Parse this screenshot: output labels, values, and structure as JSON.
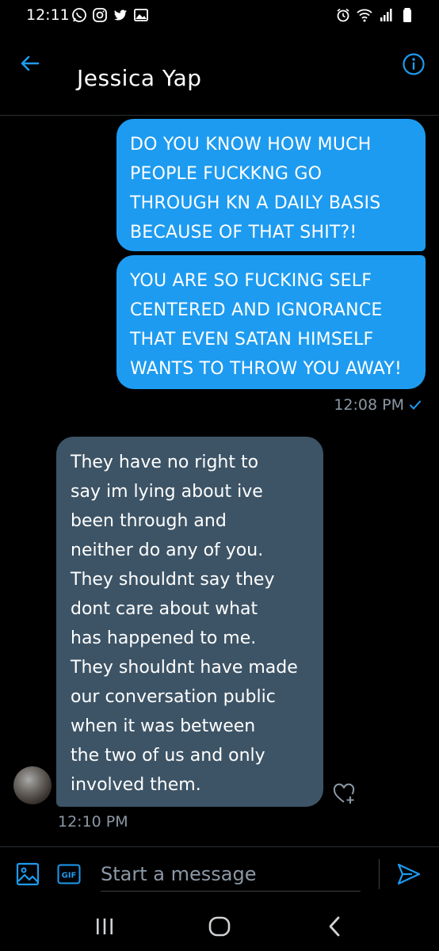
{
  "status_bar": {
    "time": "12:11",
    "left_icons": [
      "whatsapp-icon",
      "instagram-icon",
      "twitter-icon",
      "gallery-icon"
    ],
    "right_icons": [
      "alarm-icon",
      "wifi-icon",
      "signal-icon",
      "battery-icon"
    ]
  },
  "header": {
    "title": "Jessica Yap",
    "back_icon": "arrow-left-icon",
    "info_icon": "info-icon"
  },
  "messages": {
    "outgoing": [
      {
        "lines": [
          "DO YOU KNOW HOW MUCH",
          "PEOPLE FUCKKNG GO",
          "THROUGH KN A DAILY BASIS",
          "BECAUSE OF THAT SHIT?!"
        ]
      },
      {
        "lines": [
          "YOU ARE SO FUCKING SELF",
          "CENTERED AND IGNORANCE",
          "THAT EVEN SATAN HIMSELF",
          "WANTS TO THROW YOU AWAY!"
        ]
      }
    ],
    "outgoing_time": "12:08 PM",
    "incoming": {
      "lines": [
        "They have no right to",
        "say im lying about ive",
        "been through and",
        "neither do any of you.",
        "They shouldnt say they",
        "dont care about what",
        "has happened to me.",
        "They shouldnt have made",
        "our conversation public",
        "when it was between",
        "the two of us and only",
        "involved them."
      ],
      "time": "12:10 PM"
    }
  },
  "composer": {
    "placeholder": "Start a message",
    "gif_label": "GIF"
  },
  "colors": {
    "accent": "#1d9bf0",
    "incoming_bubble": "#3d5466",
    "muted": "#8b98a5",
    "background": "#000000"
  }
}
